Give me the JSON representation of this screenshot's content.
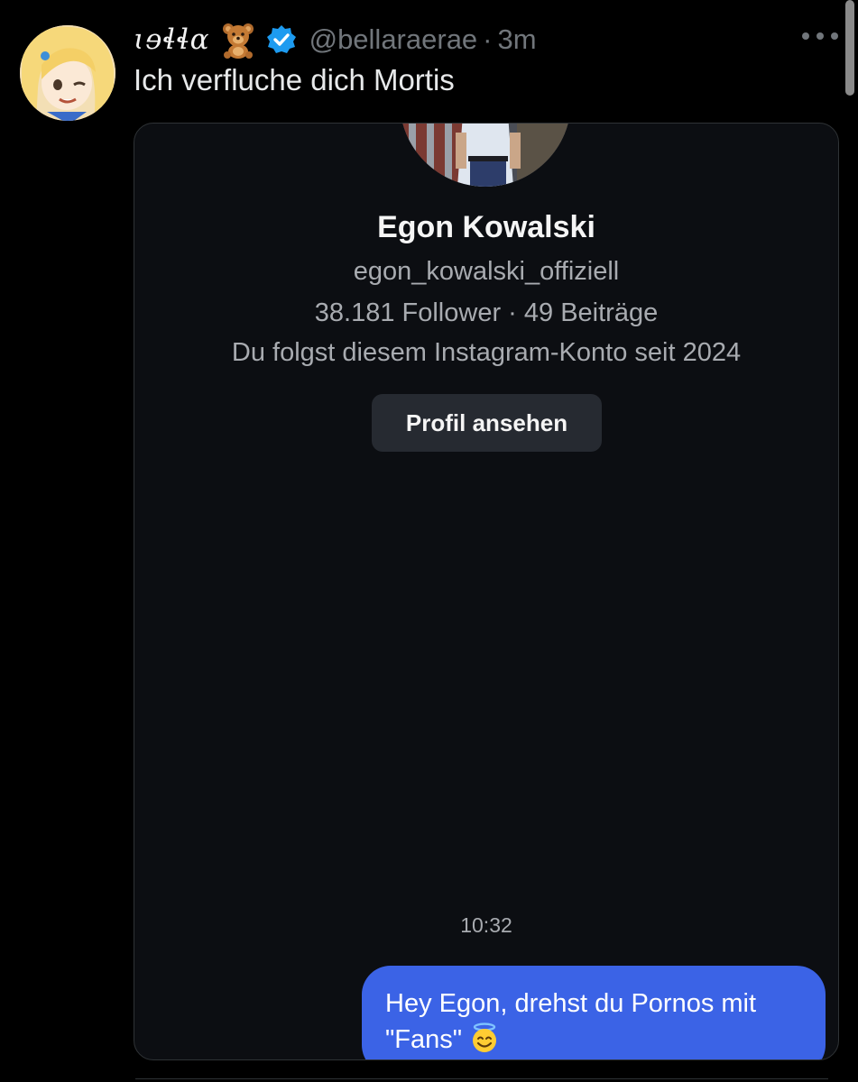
{
  "tweet": {
    "display_name": "ɩɘɬɬɑ",
    "display_emoji": "bear-emoji",
    "verified": true,
    "handle": "@bellaraerae",
    "separator": "·",
    "time": "3m",
    "text": "Ich verfluche dich Mortis"
  },
  "media_screenshot": {
    "profile": {
      "name": "Egon Kowalski",
      "username": "egon_kowalski_offiziell",
      "stats": "38.181 Follower · 49 Beiträge",
      "follow_info": "Du folgst diesem Instagram-Konto seit 2024",
      "view_profile_label": "Profil ansehen"
    },
    "message_timestamp": "10:32",
    "message_text": "Hey Egon, drehst du Pornos mit \"Fans\""
  },
  "colors": {
    "background": "#000000",
    "card_background": "#0c0e12",
    "message_bubble": "#3b63e6",
    "verified_badge": "#1d9bf0",
    "secondary_text": "#71767b"
  },
  "icons": {
    "more": "more-horizontal-icon",
    "verified": "verified-badge-icon",
    "emoji": "smiling-face-with-halo-icon"
  }
}
